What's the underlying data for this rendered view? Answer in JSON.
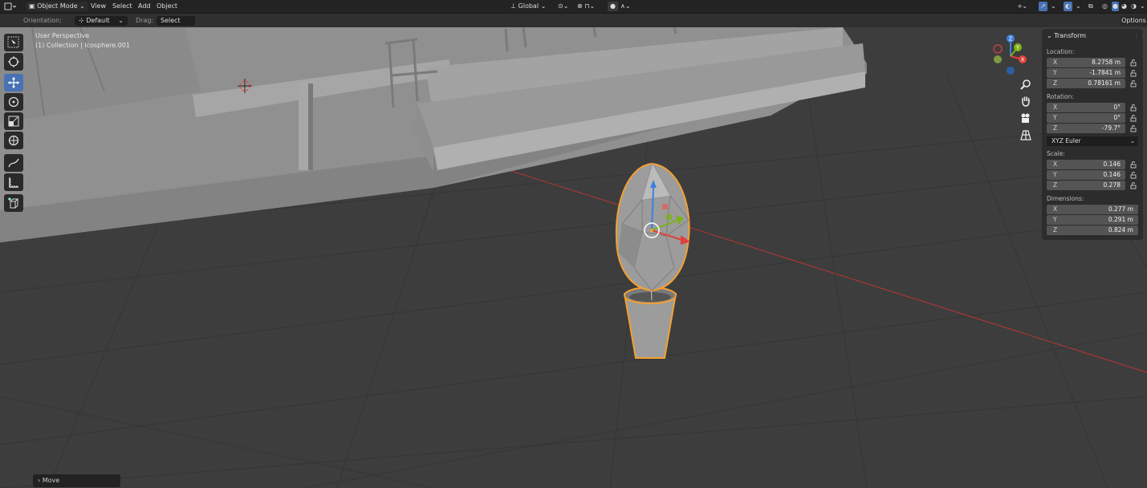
{
  "header": {
    "mode": "Object Mode",
    "menus": [
      "View",
      "Select",
      "Add",
      "Object"
    ],
    "transform_orientation": "Global"
  },
  "tool_options": {
    "orientation_label": "Orientation:",
    "orientation_value": "Default",
    "drag_label": "Drag:",
    "drag_value": "Select Box",
    "options_label": "Options"
  },
  "viewport": {
    "view_name": "User Perspective",
    "collection_info": "(1) Collection | Icosphere.001"
  },
  "gizmo": {
    "x": "X",
    "y": "Y",
    "z": "Z"
  },
  "transform_panel": {
    "title": "Transform",
    "location_label": "Location:",
    "location": [
      {
        "axis": "X",
        "value": "8.2758 m"
      },
      {
        "axis": "Y",
        "value": "-1.7841 m"
      },
      {
        "axis": "Z",
        "value": "0.78161 m"
      }
    ],
    "rotation_label": "Rotation:",
    "rotation": [
      {
        "axis": "X",
        "value": "0°"
      },
      {
        "axis": "Y",
        "value": "0°"
      },
      {
        "axis": "Z",
        "value": "-79.7°"
      }
    ],
    "rotation_mode": "XYZ Euler",
    "scale_label": "Scale:",
    "scale": [
      {
        "axis": "X",
        "value": "0.146"
      },
      {
        "axis": "Y",
        "value": "0.146"
      },
      {
        "axis": "Z",
        "value": "0.278"
      }
    ],
    "dimensions_label": "Dimensions:",
    "dimensions": [
      {
        "axis": "X",
        "value": "0.277 m"
      },
      {
        "axis": "Y",
        "value": "0.291 m"
      },
      {
        "axis": "Z",
        "value": "0.824 m"
      }
    ]
  },
  "last_operator": {
    "label": "Move"
  },
  "colors": {
    "accent": "#4772b3",
    "selection": "#f5a030",
    "x_axis": "#e0403c",
    "y_axis": "#7ab317",
    "z_axis": "#3d7fe0"
  }
}
